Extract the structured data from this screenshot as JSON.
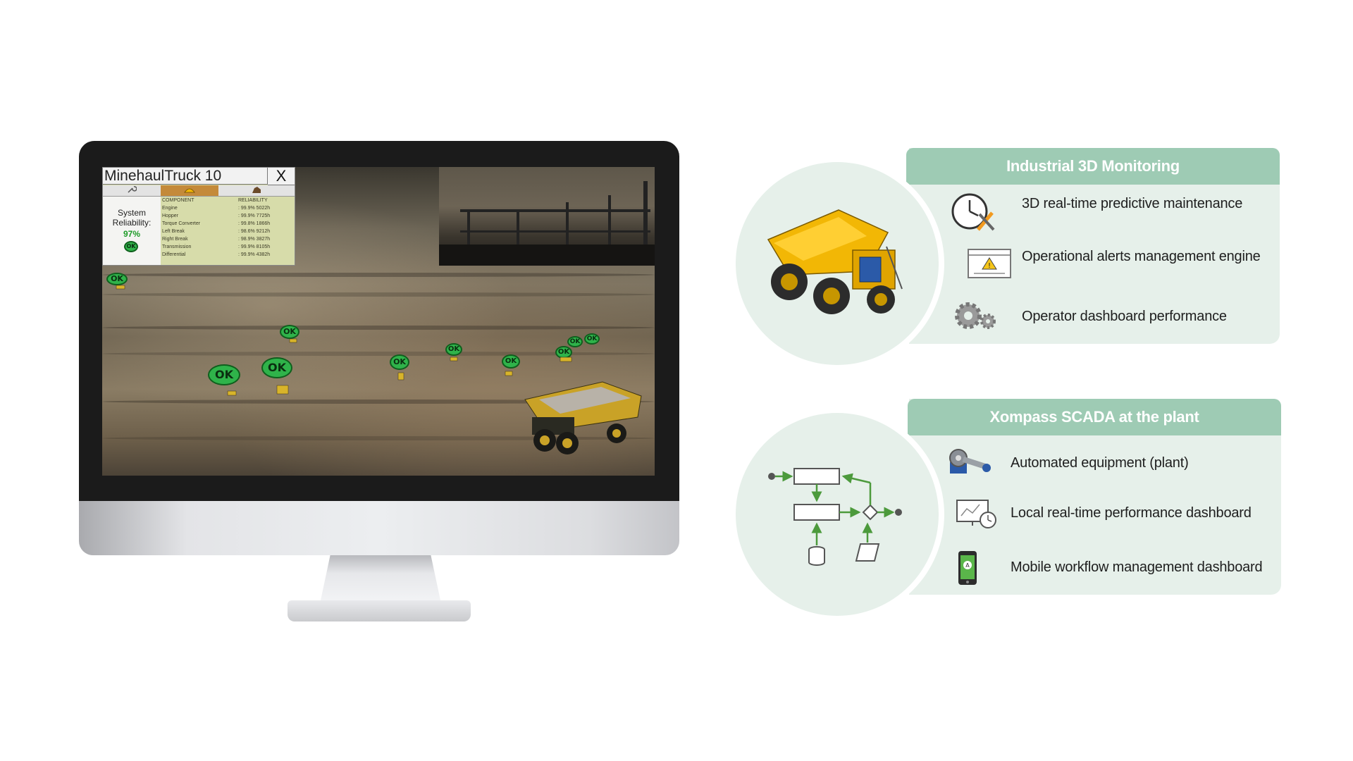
{
  "monitor": {
    "hud": {
      "title": "MinehaulTruck 10",
      "close_label": "X",
      "tabs": [
        "wrench-icon",
        "hardhat-icon",
        "ore-icon"
      ],
      "system_reliability_label": "System Reliability:",
      "system_reliability_value": "97%",
      "status": "OK",
      "table": {
        "headers": [
          "COMPONENT",
          "RELIABILITY"
        ],
        "rows": [
          {
            "component": "Engine",
            "reliability": ": 99.9% 5022h"
          },
          {
            "component": "Hopper",
            "reliability": ": 99.9% 7725h"
          },
          {
            "component": "Torque Converter",
            "reliability": ": 99.8% 1866h"
          },
          {
            "component": "Left Break",
            "reliability": ": 98.6% 9212h"
          },
          {
            "component": "Right Break",
            "reliability": ": 98.9% 3827h"
          },
          {
            "component": "Transmission",
            "reliability": ": 99.9% 8105h"
          },
          {
            "component": "Differential",
            "reliability": ": 99.9% 4382h"
          }
        ]
      }
    },
    "scene_badges": [
      "OK",
      "OK",
      "OK",
      "OK",
      "OK",
      "OK",
      "OK",
      "OK",
      "OK",
      "OK",
      "OK"
    ]
  },
  "panels": [
    {
      "title": "Industrial 3D Monitoring",
      "illustration": "mining-dump-truck",
      "features": [
        {
          "icon": "clock-wrench-icon",
          "label": "3D real-time predictive maintenance"
        },
        {
          "icon": "alert-window-icon",
          "label": "Operational alerts management engine"
        },
        {
          "icon": "gears-icon",
          "label": "Operator dashboard performance"
        }
      ]
    },
    {
      "title": "Xompass SCADA at the plant",
      "illustration": "process-flow-diagram",
      "features": [
        {
          "icon": "plant-machine-icon",
          "label": "Automated equipment (plant)"
        },
        {
          "icon": "monitor-clock-icon",
          "label": "Local real-time performance dashboard"
        },
        {
          "icon": "mobile-phone-icon",
          "label": "Mobile workflow management dashboard"
        }
      ]
    }
  ],
  "colors": {
    "panel_header": "#9ecbb4",
    "panel_body": "#e6f0ea",
    "ok_green": "#2fb34a",
    "truck_yellow": "#f2b705"
  }
}
